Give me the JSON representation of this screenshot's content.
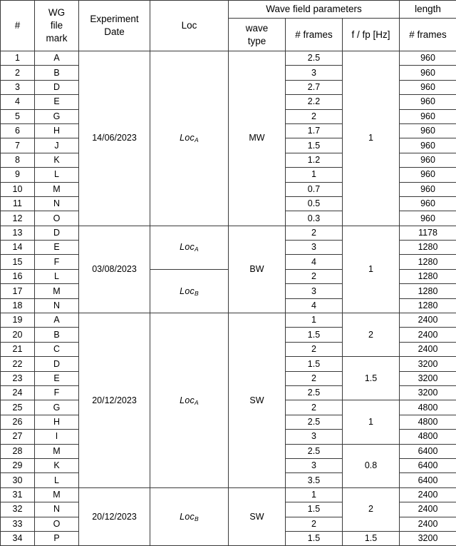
{
  "table": {
    "header": {
      "group_row": [
        {
          "label": "#",
          "name": "header-number"
        },
        {
          "label": "WG file mark",
          "name": "header-wg-file-mark",
          "lines": [
            "WG",
            "file",
            "mark"
          ]
        },
        {
          "label": "Experiment Date",
          "name": "header-experiment-date",
          "lines": [
            "Experiment",
            "Date"
          ]
        },
        {
          "label": "Loc",
          "name": "header-loc",
          "lines": [
            "Loc"
          ]
        },
        {
          "label": "Wave field parameters",
          "name": "header-wave-field-parameters"
        },
        {
          "label": "length",
          "name": "header-length"
        }
      ],
      "sub_row": [
        {
          "label": "wave type",
          "name": "header-wave-type",
          "lines": [
            "wave",
            "type"
          ]
        },
        {
          "label": "# frames",
          "name": "header-wave-frames"
        },
        {
          "label": "f / fp [Hz]",
          "name": "header-f-fp-hz"
        },
        {
          "label": "# frames",
          "name": "header-length-frames"
        }
      ]
    },
    "rows": [
      {
        "num": "1",
        "wg": "A",
        "frames": "2.5",
        "length": "960"
      },
      {
        "num": "2",
        "wg": "B",
        "frames": "3",
        "length": "960"
      },
      {
        "num": "3",
        "wg": "D",
        "frames": "2.7",
        "length": "960"
      },
      {
        "num": "4",
        "wg": "E",
        "frames": "2.2",
        "length": "960"
      },
      {
        "num": "5",
        "wg": "G",
        "frames": "2",
        "length": "960"
      },
      {
        "num": "6",
        "wg": "H",
        "frames": "1.7",
        "length": "960"
      },
      {
        "num": "7",
        "wg": "J",
        "frames": "1.5",
        "length": "960"
      },
      {
        "num": "8",
        "wg": "K",
        "frames": "1.2",
        "length": "960"
      },
      {
        "num": "9",
        "wg": "L",
        "frames": "1",
        "length": "960"
      },
      {
        "num": "10",
        "wg": "M",
        "frames": "0.7",
        "length": "960"
      },
      {
        "num": "11",
        "wg": "N",
        "frames": "0.5",
        "length": "960"
      },
      {
        "num": "12",
        "wg": "O",
        "frames": "0.3",
        "length": "960"
      },
      {
        "num": "13",
        "wg": "D",
        "frames": "2",
        "length": "1178"
      },
      {
        "num": "14",
        "wg": "E",
        "frames": "3",
        "length": "1280"
      },
      {
        "num": "15",
        "wg": "F",
        "frames": "4",
        "length": "1280"
      },
      {
        "num": "16",
        "wg": "L",
        "frames": "2",
        "length": "1280"
      },
      {
        "num": "17",
        "wg": "M",
        "frames": "3",
        "length": "1280"
      },
      {
        "num": "18",
        "wg": "N",
        "frames": "4",
        "length": "1280"
      },
      {
        "num": "19",
        "wg": "A",
        "frames": "1",
        "length": "2400"
      },
      {
        "num": "20",
        "wg": "B",
        "frames": "1.5",
        "length": "2400"
      },
      {
        "num": "21",
        "wg": "C",
        "frames": "2",
        "length": "2400"
      },
      {
        "num": "22",
        "wg": "D",
        "frames": "1.5",
        "length": "3200"
      },
      {
        "num": "23",
        "wg": "E",
        "frames": "2",
        "length": "3200"
      },
      {
        "num": "24",
        "wg": "F",
        "frames": "2.5",
        "length": "3200"
      },
      {
        "num": "25",
        "wg": "G",
        "frames": "2",
        "length": "4800"
      },
      {
        "num": "26",
        "wg": "H",
        "frames": "2.5",
        "length": "4800"
      },
      {
        "num": "27",
        "wg": "I",
        "frames": "3",
        "length": "4800"
      },
      {
        "num": "28",
        "wg": "M",
        "frames": "2.5",
        "length": "6400"
      },
      {
        "num": "29",
        "wg": "K",
        "frames": "3",
        "length": "6400"
      },
      {
        "num": "30",
        "wg": "L",
        "frames": "3.5",
        "length": "6400"
      },
      {
        "num": "31",
        "wg": "M",
        "frames": "1",
        "length": "2400"
      },
      {
        "num": "32",
        "wg": "N",
        "frames": "1.5",
        "length": "2400"
      },
      {
        "num": "33",
        "wg": "O",
        "frames": "2",
        "length": "2400"
      },
      {
        "num": "34",
        "wg": "P",
        "frames": "1.5",
        "length": "3200"
      }
    ],
    "merged": {
      "dates": [
        {
          "value": "14/06/2023",
          "start": 1,
          "span": 12
        },
        {
          "value": "03/08/2023",
          "start": 13,
          "span": 6
        },
        {
          "value": "20/12/2023",
          "start": 19,
          "span": 12
        },
        {
          "value": "20/12/2023",
          "start": 31,
          "span": 4
        }
      ],
      "locations": [
        {
          "base": "Loc",
          "sub": "A",
          "start": 1,
          "span": 12
        },
        {
          "base": "Loc",
          "sub": "A",
          "start": 13,
          "span": 3
        },
        {
          "base": "Loc",
          "sub": "B",
          "start": 16,
          "span": 3
        },
        {
          "base": "Loc",
          "sub": "A",
          "start": 19,
          "span": 12
        },
        {
          "base": "Loc",
          "sub": "B",
          "start": 31,
          "span": 4
        }
      ],
      "wave_types": [
        {
          "value": "MW",
          "start": 1,
          "span": 12
        },
        {
          "value": "BW",
          "start": 13,
          "span": 6
        },
        {
          "value": "SW",
          "start": 19,
          "span": 12
        },
        {
          "value": "SW",
          "start": 31,
          "span": 4
        }
      ],
      "f_fp": [
        {
          "value": "1",
          "start": 1,
          "span": 12
        },
        {
          "value": "1",
          "start": 13,
          "span": 6
        },
        {
          "value": "2",
          "start": 19,
          "span": 3
        },
        {
          "value": "1.5",
          "start": 22,
          "span": 3
        },
        {
          "value": "1",
          "start": 25,
          "span": 3
        },
        {
          "value": "0.8",
          "start": 28,
          "span": 3
        },
        {
          "value": "2",
          "start": 31,
          "span": 3
        },
        {
          "value": "1.5",
          "start": 34,
          "span": 1
        }
      ]
    }
  }
}
